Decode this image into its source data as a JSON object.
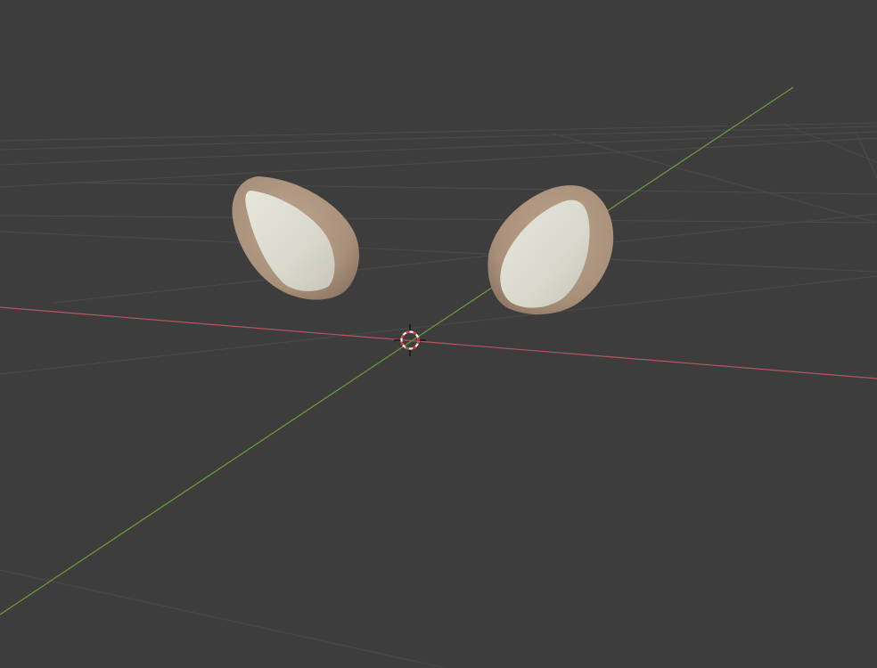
{
  "viewport": {
    "background_color": "#3d3d3d",
    "grid_color": "#4a4a4a",
    "x_axis_color": "#b9545e",
    "y_axis_color": "#6f9a3a",
    "cursor_icon": "3d-cursor-icon",
    "cursor_colors": {
      "ring_red": "#e0333a",
      "ring_white": "#ffffff",
      "crosshair": "#111111"
    }
  },
  "objects": [
    {
      "name": "left-ear",
      "outer_color": "#a8907a",
      "inner_color": "#d9d8cc"
    },
    {
      "name": "right-ear",
      "outer_color": "#a8907a",
      "inner_color": "#d9d8cc"
    }
  ]
}
